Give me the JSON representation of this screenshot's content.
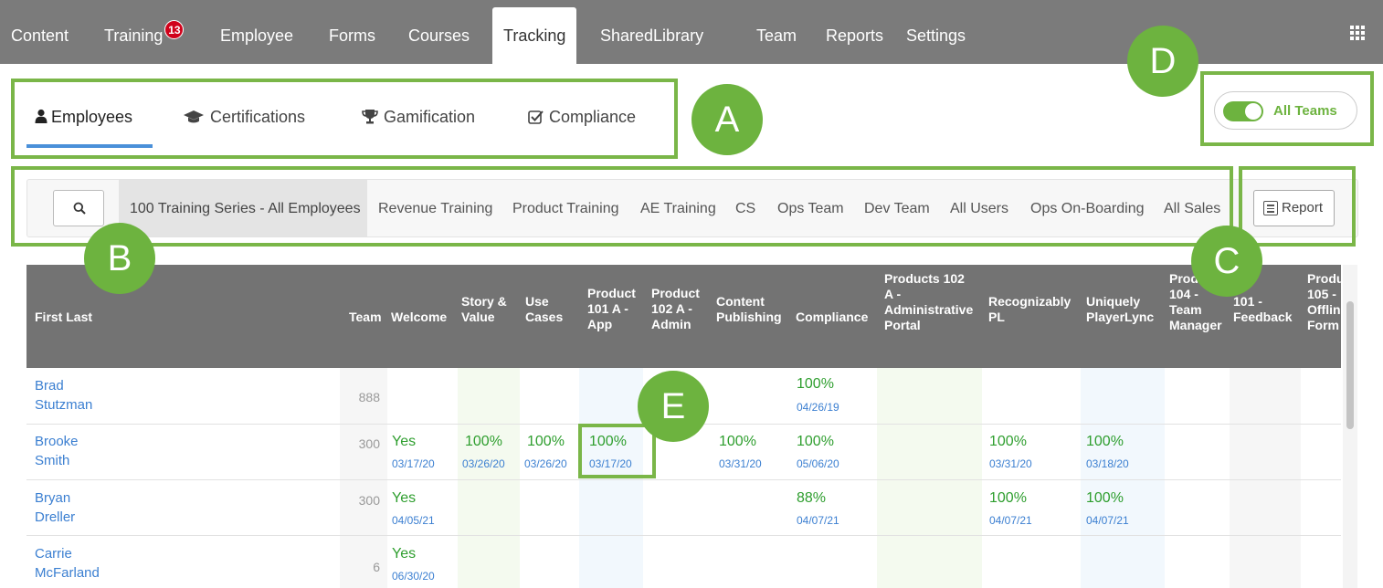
{
  "nav": {
    "items": [
      {
        "label": "Content"
      },
      {
        "label": "Training",
        "badge": "13"
      },
      {
        "label": "Employee"
      },
      {
        "label": "Forms"
      },
      {
        "label": "Courses"
      },
      {
        "label": "Tracking",
        "active": true
      },
      {
        "label": "SharedLibrary"
      },
      {
        "label": "Team"
      },
      {
        "label": "Reports"
      },
      {
        "label": "Settings"
      }
    ],
    "apps_icon": "grid-icon"
  },
  "subtabs": [
    {
      "label": "Employees",
      "icon": "user-icon",
      "active": true
    },
    {
      "label": "Certifications",
      "icon": "graduation-cap-icon"
    },
    {
      "label": "Gamification",
      "icon": "trophy-icon"
    },
    {
      "label": "Compliance",
      "icon": "check-square-icon"
    }
  ],
  "toggle": {
    "label": "All Teams",
    "on": true
  },
  "filters": {
    "search_icon": "search-icon",
    "items": [
      {
        "label": "100 Training Series - All Employees",
        "active": true
      },
      {
        "label": "Revenue Training"
      },
      {
        "label": "Product Training"
      },
      {
        "label": "AE Training"
      },
      {
        "label": "CS"
      },
      {
        "label": "Ops Team"
      },
      {
        "label": "Dev Team"
      },
      {
        "label": "All Users"
      },
      {
        "label": "Ops On-Boarding"
      },
      {
        "label": "All Sales"
      }
    ],
    "report_label": "Report"
  },
  "callouts": [
    "A",
    "B",
    "C",
    "D",
    "E"
  ],
  "table": {
    "headers": {
      "name": "First  Last",
      "team": "Team",
      "welcome": "Welcome",
      "story": [
        "Story &",
        "Value"
      ],
      "usecases": [
        "Use",
        "Cases"
      ],
      "p101a": [
        "Product",
        "101 A -",
        "App"
      ],
      "p102a": [
        "Product",
        "102 A -",
        "Admin"
      ],
      "content": [
        "Content",
        "Publishing"
      ],
      "compliance": "Compliance",
      "p102admin": [
        "Products 102",
        "A -",
        "Administrative",
        "Portal"
      ],
      "recog": [
        "Recognizably",
        "PL"
      ],
      "uniquely": [
        "Uniquely",
        "PlayerLync"
      ],
      "p104": [
        "Prod",
        "104 -",
        "Team",
        "Manager"
      ],
      "f101": [
        "101 -",
        "Feedback"
      ],
      "p105": [
        "Produ",
        "105 -",
        "Offlin",
        "Form"
      ]
    },
    "rows": [
      {
        "first": "Brad",
        "last": "Stutzman",
        "team": "888",
        "compliance": {
          "v": "100%",
          "d": "04/26/19"
        }
      },
      {
        "first": "Brooke",
        "last": "Smith",
        "team": "300",
        "welcome": {
          "v": "Yes",
          "d": "03/17/20"
        },
        "story": {
          "v": "100%",
          "d": "03/26/20"
        },
        "usecases": {
          "v": "100%",
          "d": "03/26/20"
        },
        "p101a": {
          "v": "100%",
          "d": "03/17/20"
        },
        "content": {
          "v": "100%",
          "d": "03/31/20"
        },
        "compliance": {
          "v": "100%",
          "d": "05/06/20"
        },
        "recog": {
          "v": "100%",
          "d": "03/31/20"
        },
        "uniquely": {
          "v": "100%",
          "d": "03/18/20"
        }
      },
      {
        "first": "Bryan",
        "last": "Dreller",
        "team": "300",
        "welcome": {
          "v": "Yes",
          "d": "04/05/21"
        },
        "compliance": {
          "v": "88%",
          "d": "04/07/21"
        },
        "recog": {
          "v": "100%",
          "d": "04/07/21"
        },
        "uniquely": {
          "v": "100%",
          "d": "04/07/21"
        }
      },
      {
        "first": "Carrie",
        "last": "McFarland",
        "team": "6",
        "welcome": {
          "v": "Yes",
          "d": "06/30/20"
        }
      }
    ]
  },
  "colors": {
    "accent": "#6db33f",
    "header_bg": "#737373",
    "nav_bg": "#7b7b7b",
    "link": "#3b7fd1",
    "value": "#2e9e2e"
  }
}
